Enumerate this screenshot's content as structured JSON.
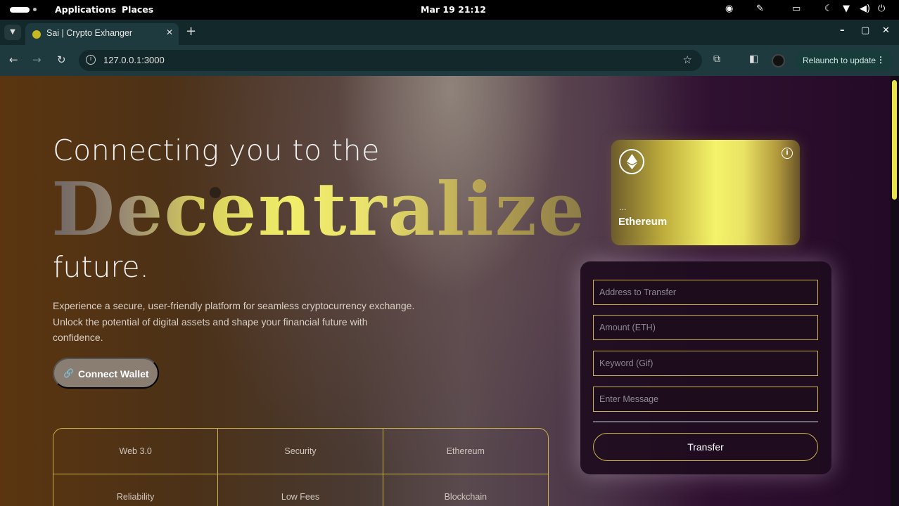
{
  "system_bar": {
    "menu_applications": "Applications",
    "menu_places": "Places",
    "clock": "Mar 19  21:12"
  },
  "browser": {
    "tab_title": "Sai | Crypto Exhanger",
    "url": "127.0.0.1:3000",
    "relaunch_label": "Relaunch to update"
  },
  "hero": {
    "line1": "Connecting you to the",
    "big_word": "Decentralize",
    "line3": "future.",
    "description": "Experience a secure, user-friendly platform for seamless cryptocurrency exchange. Unlock the potential of digital assets and shape your financial future with confidence.",
    "connect_label": "Connect Wallet"
  },
  "features": [
    "Web 3.0",
    "Security",
    "Ethereum",
    "Reliability",
    "Low Fees",
    "Blockchain"
  ],
  "card": {
    "address": "...",
    "name": "Ethereum"
  },
  "form": {
    "address_placeholder": "Address to Transfer",
    "amount_placeholder": "Amount (ETH)",
    "keyword_placeholder": "Keyword (Gif)",
    "message_placeholder": "Enter Message",
    "submit_label": "Transfer"
  },
  "colors": {
    "accent_gold": "#c9b24a",
    "card_highlight": "#f4f36a",
    "scroll_thumb": "#e9e24a"
  }
}
